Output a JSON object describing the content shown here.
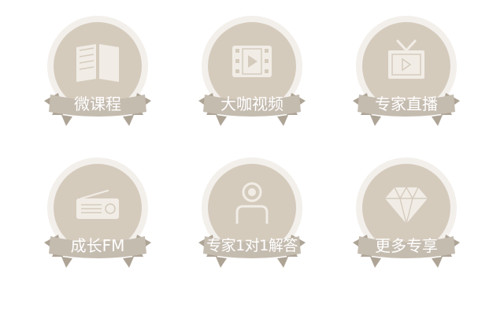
{
  "colors": {
    "halo": "#f3f0ec",
    "disc": "#d5cbbd",
    "ribbon": "#c5bcb0",
    "ribbon_tail": "#aea496",
    "icon_fill": "#f1ede6",
    "icon_stroke": "#c9bfb1",
    "label": "#ffffff"
  },
  "items": [
    {
      "label": "微课程",
      "icon": "open-book-icon"
    },
    {
      "label": "大咖视频",
      "icon": "film-play-icon"
    },
    {
      "label": "专家直播",
      "icon": "tv-play-icon"
    },
    {
      "label": "成长FM",
      "icon": "radio-icon"
    },
    {
      "label": "专家1对1解答",
      "icon": "expert-user-icon"
    },
    {
      "label": "更多专享",
      "icon": "diamond-icon"
    }
  ]
}
